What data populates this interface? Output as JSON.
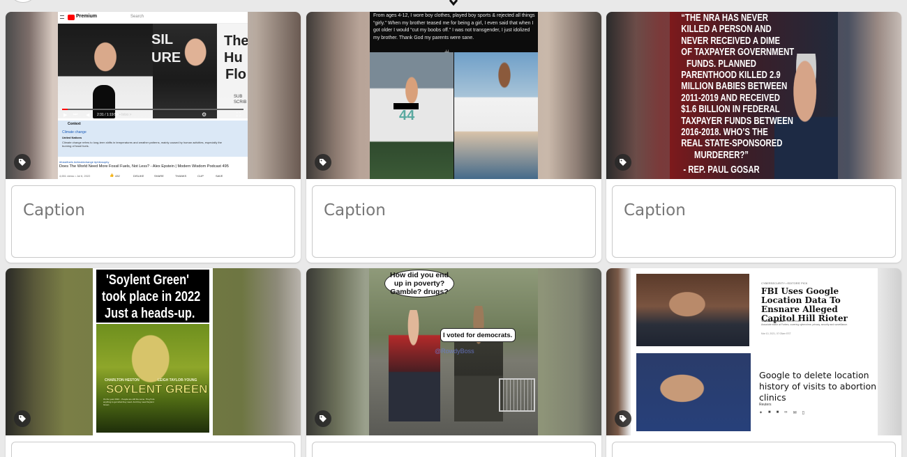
{
  "caption_placeholder": "Caption",
  "cards": [
    {
      "youtube": {
        "brand": "Premium",
        "search_placeholder": "Search",
        "overlay_letters": [
          "SIL",
          "URE",
          "The",
          "Hu",
          "Flo"
        ],
        "overlay_sub": [
          "SUB",
          "SCRIB"
        ],
        "time": "2:31 / 1:19:54",
        "chapter": "• Intro >",
        "context_label": "Context",
        "context_link": "Climate change",
        "context_source": "United Nations",
        "context_text": "Climate change refers to long-term shifts in temperatures and weather patterns, mainly caused by human activities, especially the burning of fossil fuels.",
        "hashtags": "#fossilfuels #climatechange #philosophy",
        "video_title": "Does The World Need More Fossil Fuels, Not Less? - Alex Epstein | Modern Wisdom Podcast 495",
        "views": "4,651 views • Jul 6, 2022",
        "likes": "432",
        "actions": [
          "DISLIKE",
          "SHARE",
          "THANKS",
          "CLIP",
          "SAVE"
        ]
      }
    },
    {
      "meme_text": "From ages 4-12, I wore boy clothes, played boy sports & rejected all things “girly.” When my brother teased me for being a girl, I even said that when I got older I would “cut my boobs off.” I was not transgender, I just idolized my brother. Thank God my parents were sane.",
      "jersey_number": "44",
      "hash_symbol": "#"
    },
    {
      "quote_lines": [
        "“THE NRA HAS NEVER",
        "KILLED A PERSON AND",
        "NEVER RECEIVED A DIME",
        "OF TAXPAYER GOVERNMENT",
        "FUNDS. PLANNED",
        "PARENTHOOD KILLED 2.9",
        "MILLION BABIES BETWEEN",
        "2011-2019 AND RECEIVED",
        "$1.6 BILLION IN FEDERAL",
        "TAXPAYER FUNDS BETWEEN",
        "2016-2018. WHO’S THE",
        "REAL STATE-SPONSORED",
        "MURDERER?”"
      ],
      "attribution": "- REP. PAUL GOSAR"
    },
    {
      "headline_lines": [
        "'Soylent Green'",
        "took place in 2022",
        "Just a heads-up."
      ],
      "poster_credits": [
        "CHARLTON HESTON",
        "LEIGH TAYLOR-YOUNG"
      ],
      "poster_title": "SOYLENT GREEN",
      "poster_tagline": "It's the year 2022... People are still the same. They'll do anything to get what they need. And they need Soylent Green."
    },
    {
      "bubble_question": "How did you end up in poverty? Gamble? drugs?",
      "bubble_answer": "I voted for democrats.",
      "watermark": "@RowdyBoss"
    },
    {
      "kicker": "CYBERSECURITY • EDITORS' PICK",
      "headline1": "FBI Uses Google Location Data To Ensnare Alleged Capitol Hill Rioter",
      "author": "Thomas Brewster",
      "author_role": "Forbes Staff",
      "author_bio": "Associate editor at Forbes, covering cybercrime, privacy, security and surveillance.",
      "date": "Mar 10, 2021, 07:03am EST",
      "headline2": "Google to delete location history of visits to abortion clinics",
      "source": "Reuters"
    }
  ],
  "colors": {
    "page_bg": "#e9e9e9",
    "card_bg": "#ffffff",
    "caption_border": "#c9c9c9",
    "caption_text": "#777777",
    "youtube_red": "#ff0000",
    "context_bg": "#dbe8f6"
  }
}
